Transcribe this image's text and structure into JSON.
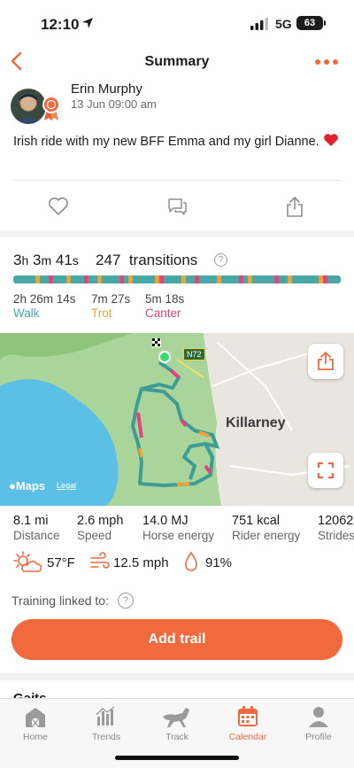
{
  "status": {
    "time": "12:10",
    "network": "5G",
    "battery": "63"
  },
  "nav": {
    "title": "Summary",
    "back_icon": "chevron-left-icon",
    "more_icon": "more-dots-icon"
  },
  "post": {
    "user": "Erin Murphy",
    "date": "13 Jun 09:00 am",
    "text": "Irish ride with my new BFF Emma and my girl Dianne.",
    "actions": [
      "heart-icon",
      "comment-icon",
      "share-icon"
    ]
  },
  "summary": {
    "duration": {
      "h": "3",
      "m": "3",
      "s": "41"
    },
    "transitions_count": "247",
    "transitions_label": "transitions",
    "gaits": [
      {
        "time": "2h 26m 14s",
        "label": "Walk",
        "color": "#4aa7a7"
      },
      {
        "time": "7m 27s",
        "label": "Trot",
        "color": "#e8a33a"
      },
      {
        "time": "5m 18s",
        "label": "Canter",
        "color": "#e0457b"
      }
    ]
  },
  "map": {
    "attribution": "Maps",
    "legal": "Legal",
    "town": "Killarney",
    "road": "N72"
  },
  "metrics": [
    {
      "value": "8.1 mi",
      "label": "Distance"
    },
    {
      "value": "2.6 mph",
      "label": "Speed"
    },
    {
      "value": "14.0 MJ",
      "label": "Horse energy"
    },
    {
      "value": "751 kcal",
      "label": "Rider energy"
    },
    {
      "value": "12062",
      "label": "Strides"
    }
  ],
  "weather": {
    "temperature": "57°F",
    "wind": "12.5 mph",
    "humidity": "91%"
  },
  "training": {
    "label": "Training linked to:"
  },
  "add_trail": "Add trail",
  "gaits_section": "Gaits",
  "tabs": [
    {
      "label": "Home",
      "icon": "barn-icon",
      "active": false
    },
    {
      "label": "Trends",
      "icon": "trends-icon",
      "active": false
    },
    {
      "label": "Track",
      "icon": "horse-icon",
      "active": false
    },
    {
      "label": "Calendar",
      "icon": "calendar-icon",
      "active": true
    },
    {
      "label": "Profile",
      "icon": "profile-icon",
      "active": false
    }
  ],
  "accent_color": "#f06a3d"
}
